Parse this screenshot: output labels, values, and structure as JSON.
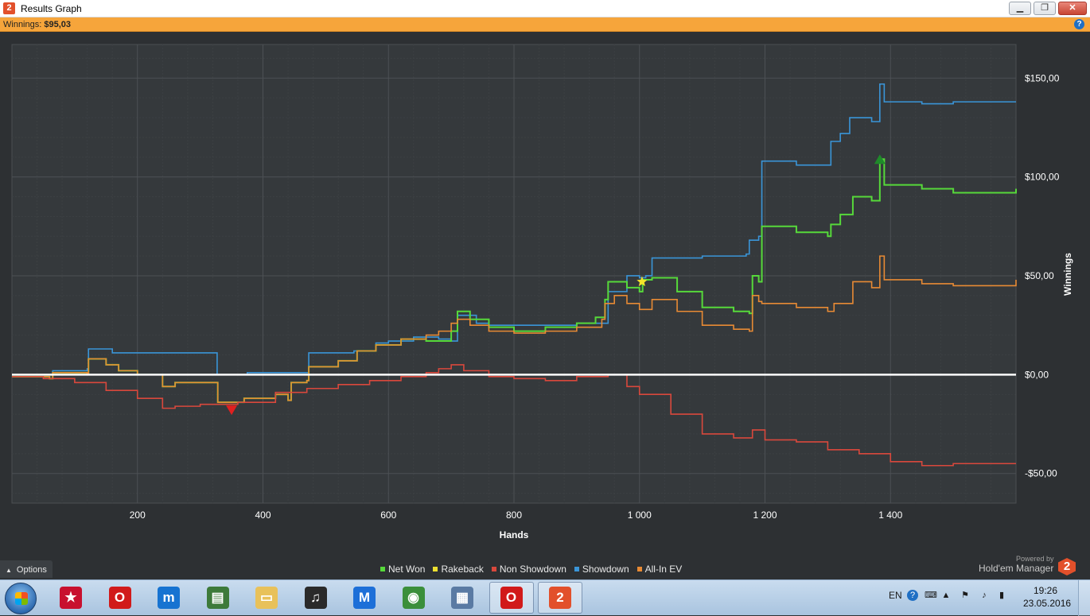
{
  "window": {
    "title": "Results Graph",
    "app_icon": "2",
    "minimize_icon": "minimize-icon",
    "restore_icon": "restore-icon",
    "close_icon": "close-icon"
  },
  "infobar": {
    "winnings_label": "Winnings:",
    "winnings_value": "$95,03",
    "help_icon": "help-icon",
    "help_glyph": "?"
  },
  "options": {
    "label": "Options",
    "icon": "chevron-up-icon"
  },
  "legend": [
    {
      "label": "Net Won",
      "color": "#56d93a"
    },
    {
      "label": "Rakeback",
      "color": "#ede030"
    },
    {
      "label": "Non Showdown",
      "color": "#d9483c"
    },
    {
      "label": "Showdown",
      "color": "#3a95d8"
    },
    {
      "label": "All-In EV",
      "color": "#e88a34"
    }
  ],
  "branding": {
    "powered_by": "Powered by",
    "name": "Hold'em Manager",
    "logo_text": "2"
  },
  "taskbar": {
    "apps": [
      {
        "name": "pokerstars-icon",
        "glyph": "★",
        "color": "#c8102e",
        "active": false
      },
      {
        "name": "opera-icon",
        "glyph": "O",
        "color": "#d11a1a",
        "active": false
      },
      {
        "name": "maxthon-icon",
        "glyph": "m",
        "color": "#1673d1",
        "active": false
      },
      {
        "name": "system-monitor-icon",
        "glyph": "▤",
        "color": "#3d7a3a",
        "active": false
      },
      {
        "name": "file-explorer-icon",
        "glyph": "▭",
        "color": "#e8c15a",
        "active": false
      },
      {
        "name": "headphones-app-icon",
        "glyph": "♫",
        "color": "#2a2a2a",
        "active": false
      },
      {
        "name": "malwarebytes-icon",
        "glyph": "M",
        "color": "#1d6fd8",
        "active": false
      },
      {
        "name": "chrome-icon",
        "glyph": "◉",
        "color": "#3b8f3b",
        "active": false
      },
      {
        "name": "calculator-icon",
        "glyph": "▦",
        "color": "#5a7aa3",
        "active": false
      },
      {
        "name": "opera-window-icon",
        "glyph": "O",
        "color": "#d11a1a",
        "active": true
      },
      {
        "name": "holdem-manager-icon",
        "glyph": "2",
        "color": "#e2502b",
        "active": true
      }
    ],
    "language": "EN",
    "clock_time": "19:26",
    "clock_date": "23.05.2016"
  },
  "chart_data": {
    "type": "line",
    "xlabel": "Hands",
    "ylabel": "Winnings",
    "xlim": [
      0,
      1600
    ],
    "ylim": [
      -65,
      167
    ],
    "x_ticks": [
      {
        "value": 200,
        "label": "200"
      },
      {
        "value": 400,
        "label": "400"
      },
      {
        "value": 600,
        "label": "600"
      },
      {
        "value": 800,
        "label": "800"
      },
      {
        "value": 1000,
        "label": "1 000"
      },
      {
        "value": 1200,
        "label": "1 200"
      },
      {
        "value": 1400,
        "label": "1 400"
      }
    ],
    "y_ticks": [
      {
        "value": 150,
        "label": "$150,00"
      },
      {
        "value": 100,
        "label": "$100,00"
      },
      {
        "value": 50,
        "label": "$50,00"
      },
      {
        "value": 0,
        "label": "$0,00"
      },
      {
        "value": -50,
        "label": "-$50,00"
      }
    ],
    "grid": true,
    "series": [
      {
        "name": "Showdown",
        "color": "#3a95d8",
        "points": [
          [
            0,
            0
          ],
          [
            60,
            0
          ],
          [
            65,
            2
          ],
          [
            120,
            3
          ],
          [
            122,
            13
          ],
          [
            155,
            13
          ],
          [
            160,
            11
          ],
          [
            325,
            11
          ],
          [
            327,
            0
          ],
          [
            370,
            0
          ],
          [
            375,
            1
          ],
          [
            470,
            1
          ],
          [
            473,
            11
          ],
          [
            540,
            11
          ],
          [
            545,
            12
          ],
          [
            580,
            16
          ],
          [
            600,
            17
          ],
          [
            640,
            19
          ],
          [
            680,
            18
          ],
          [
            700,
            17
          ],
          [
            710,
            30
          ],
          [
            740,
            26
          ],
          [
            760,
            25
          ],
          [
            800,
            25
          ],
          [
            850,
            25
          ],
          [
            900,
            26
          ],
          [
            950,
            42
          ],
          [
            980,
            50
          ],
          [
            1000,
            49
          ],
          [
            1010,
            50
          ],
          [
            1020,
            59
          ],
          [
            1100,
            60
          ],
          [
            1170,
            61
          ],
          [
            1175,
            68
          ],
          [
            1190,
            70
          ],
          [
            1195,
            108
          ],
          [
            1250,
            106
          ],
          [
            1300,
            106
          ],
          [
            1305,
            118
          ],
          [
            1320,
            122
          ],
          [
            1335,
            130
          ],
          [
            1370,
            128
          ],
          [
            1380,
            128
          ],
          [
            1383,
            147
          ],
          [
            1390,
            138
          ],
          [
            1450,
            137
          ],
          [
            1500,
            138
          ],
          [
            1600,
            138
          ]
        ]
      },
      {
        "name": "Net Won",
        "color": "#56d93a",
        "points": [
          [
            0,
            -1
          ],
          [
            60,
            -2
          ],
          [
            65,
            1
          ],
          [
            120,
            0
          ],
          [
            122,
            8
          ],
          [
            150,
            5
          ],
          [
            170,
            2
          ],
          [
            200,
            0
          ],
          [
            240,
            -6
          ],
          [
            260,
            -4
          ],
          [
            300,
            -4
          ],
          [
            325,
            -4
          ],
          [
            328,
            -14
          ],
          [
            370,
            -12
          ],
          [
            420,
            -10
          ],
          [
            440,
            -13
          ],
          [
            445,
            -4
          ],
          [
            470,
            -3
          ],
          [
            473,
            4
          ],
          [
            520,
            7
          ],
          [
            550,
            12
          ],
          [
            580,
            15
          ],
          [
            620,
            18
          ],
          [
            660,
            17
          ],
          [
            680,
            17
          ],
          [
            700,
            22
          ],
          [
            710,
            32
          ],
          [
            730,
            28
          ],
          [
            760,
            24
          ],
          [
            800,
            22
          ],
          [
            850,
            24
          ],
          [
            900,
            26
          ],
          [
            930,
            29
          ],
          [
            945,
            38
          ],
          [
            950,
            47
          ],
          [
            980,
            44
          ],
          [
            1000,
            42
          ],
          [
            1005,
            48
          ],
          [
            1020,
            49
          ],
          [
            1060,
            42
          ],
          [
            1100,
            34
          ],
          [
            1150,
            32
          ],
          [
            1175,
            31
          ],
          [
            1180,
            50
          ],
          [
            1190,
            47
          ],
          [
            1195,
            75
          ],
          [
            1250,
            72
          ],
          [
            1300,
            70
          ],
          [
            1305,
            76
          ],
          [
            1320,
            81
          ],
          [
            1340,
            90
          ],
          [
            1370,
            88
          ],
          [
            1380,
            88
          ],
          [
            1383,
            109
          ],
          [
            1390,
            96
          ],
          [
            1450,
            94
          ],
          [
            1500,
            92
          ],
          [
            1600,
            94
          ]
        ]
      },
      {
        "name": "All-In EV",
        "color": "#e88a34",
        "points": [
          [
            0,
            -1
          ],
          [
            60,
            -2
          ],
          [
            65,
            1
          ],
          [
            120,
            0
          ],
          [
            122,
            8
          ],
          [
            150,
            5
          ],
          [
            170,
            2
          ],
          [
            200,
            0
          ],
          [
            240,
            -6
          ],
          [
            260,
            -4
          ],
          [
            300,
            -4
          ],
          [
            325,
            -4
          ],
          [
            328,
            -14
          ],
          [
            370,
            -12
          ],
          [
            420,
            -10
          ],
          [
            440,
            -13
          ],
          [
            445,
            -4
          ],
          [
            470,
            -3
          ],
          [
            473,
            4
          ],
          [
            520,
            7
          ],
          [
            550,
            12
          ],
          [
            580,
            15
          ],
          [
            620,
            18
          ],
          [
            660,
            20
          ],
          [
            680,
            22
          ],
          [
            700,
            26
          ],
          [
            710,
            28
          ],
          [
            730,
            25
          ],
          [
            760,
            22
          ],
          [
            800,
            21
          ],
          [
            850,
            22
          ],
          [
            900,
            24
          ],
          [
            940,
            28
          ],
          [
            945,
            36
          ],
          [
            960,
            40
          ],
          [
            980,
            36
          ],
          [
            1000,
            33
          ],
          [
            1020,
            38
          ],
          [
            1060,
            32
          ],
          [
            1100,
            25
          ],
          [
            1150,
            23
          ],
          [
            1175,
            22
          ],
          [
            1180,
            40
          ],
          [
            1190,
            37
          ],
          [
            1195,
            36
          ],
          [
            1250,
            34
          ],
          [
            1300,
            32
          ],
          [
            1310,
            36
          ],
          [
            1340,
            47
          ],
          [
            1370,
            44
          ],
          [
            1380,
            44
          ],
          [
            1383,
            60
          ],
          [
            1390,
            48
          ],
          [
            1450,
            46
          ],
          [
            1500,
            45
          ],
          [
            1600,
            48
          ]
        ]
      },
      {
        "name": "Non Showdown",
        "color": "#d9483c",
        "points": [
          [
            0,
            -1
          ],
          [
            50,
            -2
          ],
          [
            100,
            -4
          ],
          [
            150,
            -8
          ],
          [
            200,
            -12
          ],
          [
            240,
            -17
          ],
          [
            260,
            -16
          ],
          [
            300,
            -15
          ],
          [
            330,
            -15
          ],
          [
            360,
            -14
          ],
          [
            420,
            -9
          ],
          [
            470,
            -7
          ],
          [
            520,
            -5
          ],
          [
            570,
            -3
          ],
          [
            620,
            -1
          ],
          [
            660,
            1
          ],
          [
            680,
            3
          ],
          [
            700,
            5
          ],
          [
            720,
            2
          ],
          [
            760,
            -1
          ],
          [
            800,
            -2
          ],
          [
            850,
            -3
          ],
          [
            900,
            -1
          ],
          [
            950,
            0
          ],
          [
            980,
            -6
          ],
          [
            1000,
            -10
          ],
          [
            1050,
            -20
          ],
          [
            1100,
            -30
          ],
          [
            1150,
            -32
          ],
          [
            1180,
            -28
          ],
          [
            1200,
            -33
          ],
          [
            1250,
            -34
          ],
          [
            1300,
            -38
          ],
          [
            1350,
            -40
          ],
          [
            1400,
            -44
          ],
          [
            1450,
            -46
          ],
          [
            1500,
            -45
          ],
          [
            1600,
            -45
          ]
        ]
      }
    ],
    "markers": [
      {
        "name": "min-marker",
        "x": 350,
        "y": -18,
        "shape": "triangle-down",
        "color": "#e02020"
      },
      {
        "name": "star-marker",
        "x": 1004,
        "y": 47,
        "shape": "star",
        "color": "#f4e32a"
      },
      {
        "name": "max-marker",
        "x": 1383,
        "y": 109,
        "shape": "triangle-up",
        "color": "#1f8a2a"
      }
    ],
    "zero_line": 0
  }
}
